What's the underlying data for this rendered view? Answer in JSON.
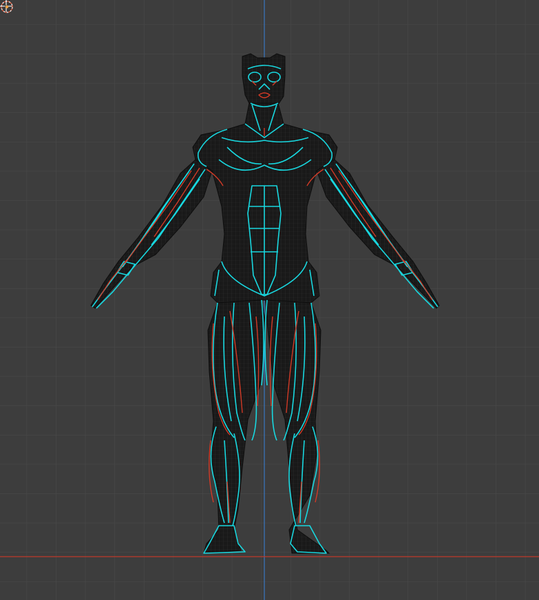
{
  "viewport": {
    "background": "#3d3d3d",
    "grid_color": "#4a4a4a",
    "axis_x_color": "#c0392b",
    "axis_z_color": "#3a78c2"
  },
  "model": {
    "type": "human muscle anatomy wireframe",
    "pose": "A-pose",
    "primary_wire_color": "#18d8e0",
    "secondary_wire_color": "#d23a26",
    "mesh_color": "#151515"
  },
  "icons": {
    "cursor": "3d-cursor-icon",
    "origin": "world-origin-icon"
  }
}
